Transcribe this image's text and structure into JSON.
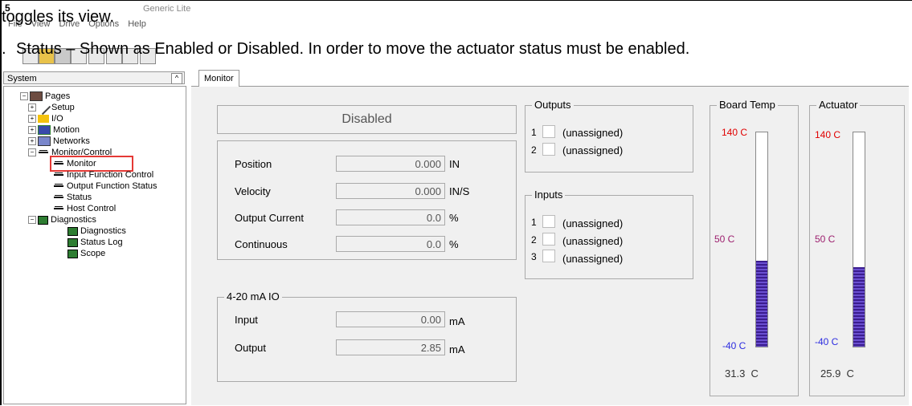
{
  "doc": {
    "line1": "toggles its view.",
    "line2_prefix": ".",
    "line2": "Status – Shown as Enabled or Disabled. In order to move the actuator status must be enabled."
  },
  "app": {
    "title_icon": "5",
    "title": "Generic Lite",
    "menu": [
      "File",
      "View",
      "Drive",
      "Options",
      "Help"
    ]
  },
  "system_panel": {
    "header": "System",
    "collapse_glyph": "^"
  },
  "tree": {
    "pages": "Pages",
    "setup": "Setup",
    "io": "I/O",
    "motion": "Motion",
    "networks": "Networks",
    "monitor_control": "Monitor/Control",
    "monitor": "Monitor",
    "input_function_control": "Input Function Control",
    "output_function_status": "Output Function Status",
    "status": "Status",
    "host_control": "Host Control",
    "diagnostics_group": "Diagnostics",
    "diagnostics": "Diagnostics",
    "status_log": "Status Log",
    "scope": "Scope"
  },
  "tab": {
    "label": "Monitor"
  },
  "monitor": {
    "status": "Disabled",
    "rows": [
      {
        "label": "Position",
        "value": "0.000",
        "unit": "IN"
      },
      {
        "label": "Velocity",
        "value": "0.000",
        "unit": "IN/S"
      },
      {
        "label": "Output Current",
        "value": "0.0",
        "unit": "%"
      },
      {
        "label": "Continuous",
        "value": "0.0",
        "unit": "%"
      }
    ],
    "io_group": {
      "title": "4-20 mA IO",
      "input_label": "Input",
      "input_value": "0.00",
      "input_unit": "mA",
      "output_label": "Output",
      "output_value": "2.85",
      "output_unit": "mA"
    },
    "outputs": {
      "title": "Outputs",
      "items": [
        {
          "num": "1",
          "label": "(unassigned)"
        },
        {
          "num": "2",
          "label": "(unassigned)"
        }
      ]
    },
    "inputs": {
      "title": "Inputs",
      "items": [
        {
          "num": "1",
          "label": "(unassigned)"
        },
        {
          "num": "2",
          "label": "(unassigned)"
        },
        {
          "num": "3",
          "label": "(unassigned)"
        }
      ]
    },
    "board_temp": {
      "title": "Board Temp",
      "max": "140 C",
      "mid": "50 C",
      "min": "-40 C",
      "value": "31.3",
      "unit": "C",
      "fill_fraction": 0.4
    },
    "actuator": {
      "title": "Actuator",
      "max": "140 C",
      "mid": "50 C",
      "min": "-40 C",
      "value": "25.9",
      "unit": "C",
      "fill_fraction": 0.37
    }
  },
  "colors": {
    "max_label": "#e00000",
    "mid_label": "#9c1f6e",
    "min_label": "#2c2ce0",
    "gauge_fill": "#3b1d8f",
    "highlight": "#e53935"
  }
}
